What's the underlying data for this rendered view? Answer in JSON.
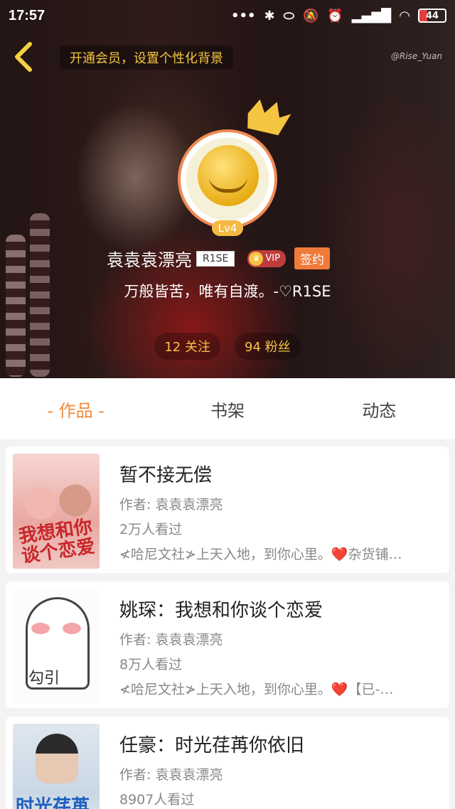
{
  "status_bar": {
    "time": "17:57",
    "icons": [
      "dots-icon",
      "bluetooth-icon",
      "toggle-icon",
      "mute-icon",
      "alarm-icon",
      "signal-icon",
      "signal-icon-2",
      "wifi-icon",
      "battery-icon"
    ],
    "battery": "44"
  },
  "header": {
    "vip_hint": "开通会员，设置个性化背景",
    "watermark": "@Rise_Yuan",
    "level": "Lv4",
    "username": "袁袁袁漂亮",
    "tag": "R1SE",
    "vip_label": "VIP",
    "sign_label": "签约",
    "motto": "万般皆苦，唯有自渡。-♡R1SE",
    "following": "12 关注",
    "fans": "94 粉丝"
  },
  "tabs": [
    {
      "label": "- 作品 -",
      "active": true
    },
    {
      "label": "书架",
      "active": false
    },
    {
      "label": "动态",
      "active": false
    }
  ],
  "books": [
    {
      "title": "暂不接无偿",
      "author": "作者: 袁袁袁漂亮",
      "views": "2万人看过",
      "desc": "≮哈尼文社≯上天入地，到你心里。❤️杂货铺…",
      "cover_text": "我想和你谈个恋爱"
    },
    {
      "title": "姚琛：我想和你谈个恋爱",
      "author": "作者: 袁袁袁漂亮",
      "views": "8万人看过",
      "desc": "≮哈尼文社≯上天入地，到你心里。❤️【已-…",
      "cover_text": "勾引"
    },
    {
      "title": "任豪：时光荏苒你依旧",
      "author": "作者: 袁袁袁漂亮",
      "views": "8907人看过",
      "desc": "",
      "cover_text": "时光荏苒"
    }
  ],
  "colors": {
    "accent": "#f08a3c",
    "gold": "#f5c542",
    "sign_badge": "#f07a3a"
  }
}
